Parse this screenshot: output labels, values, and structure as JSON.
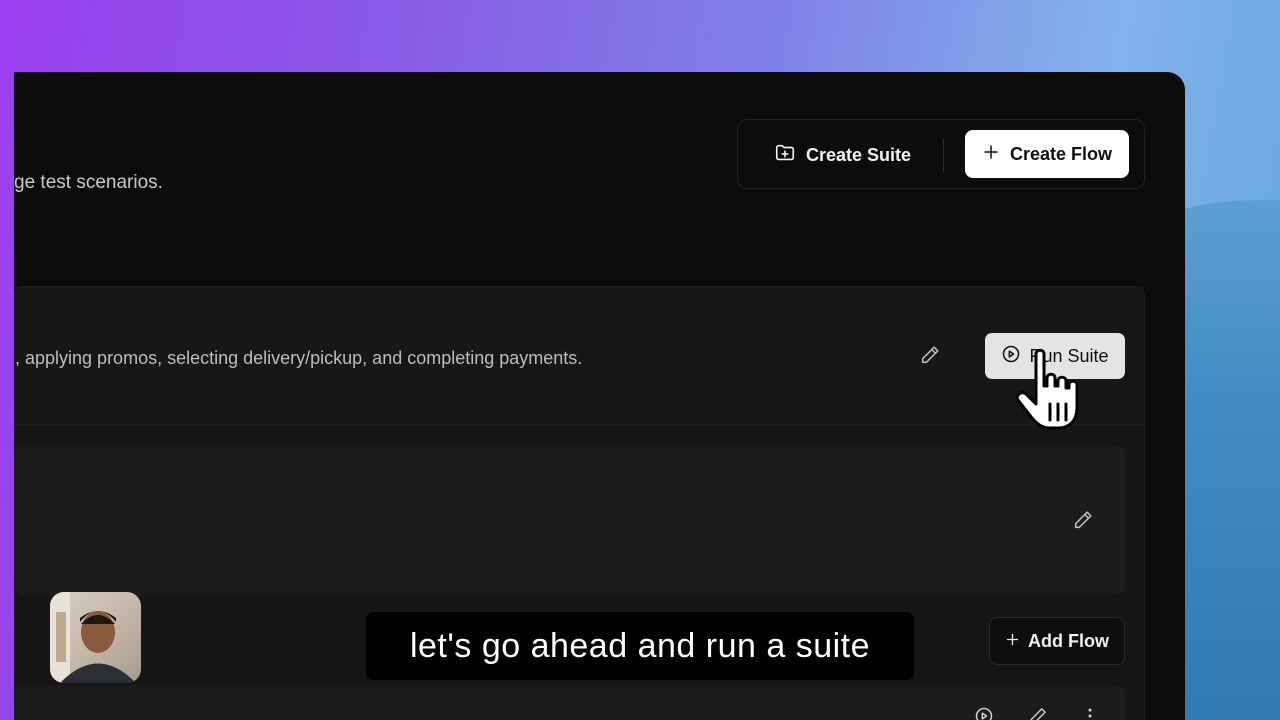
{
  "header": {
    "subtitle": "ge test scenarios."
  },
  "toolbar": {
    "create_suite_label": "Create Suite",
    "create_flow_label": "Create Flow"
  },
  "suite": {
    "description": ", applying promos, selecting delivery/pickup, and completing payments.",
    "run_label": "Run Suite"
  },
  "flows": {
    "add_flow_label": "Add Flow"
  },
  "caption": {
    "text": "let's go ahead and run a suite"
  },
  "icons": {
    "create_suite": "folder-plus-icon",
    "create_flow": "plus-icon",
    "edit": "pencil-icon",
    "run": "play-circle-icon",
    "add_flow": "plus-icon",
    "cursor": "hand-pointer-icon",
    "more": "more-vertical-icon"
  },
  "colors": {
    "window_bg": "#0b0b0b",
    "card_bg": "#161616",
    "primary_button_bg": "#ffffff",
    "run_button_bg": "#e4e4e4"
  }
}
